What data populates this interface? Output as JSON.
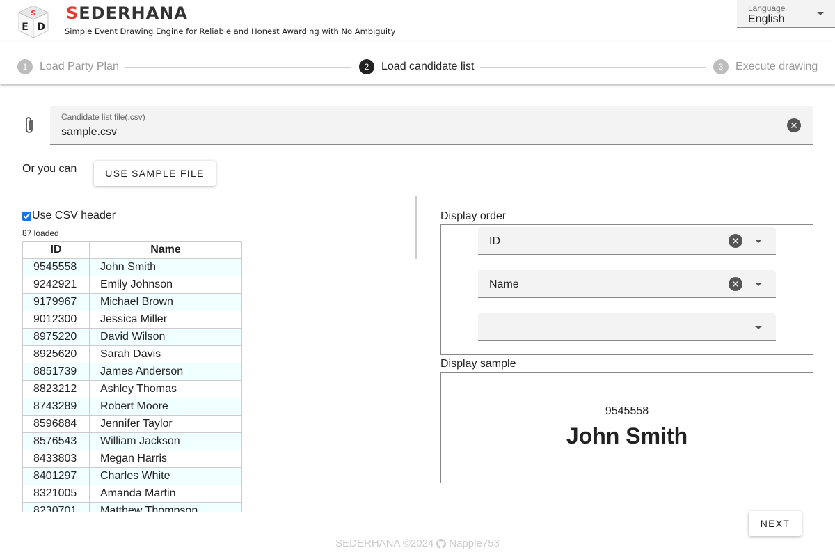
{
  "header": {
    "brand_first": "S",
    "brand_rest": "EDERHANA",
    "subtitle": "Simple Event Drawing Engine for Reliable and Honest Awarding with No Ambiguity",
    "logo_letters": [
      "S",
      "E",
      "D"
    ],
    "language": {
      "label": "Language",
      "value": "English"
    }
  },
  "stepper": {
    "steps": [
      {
        "num": "1",
        "label": "Load Party Plan",
        "active": false
      },
      {
        "num": "2",
        "label": "Load candidate list",
        "active": true
      },
      {
        "num": "3",
        "label": "Execute drawing",
        "active": false
      }
    ]
  },
  "file_input": {
    "label": "Candidate list file(.csv)",
    "value": "sample.csv",
    "icon": "paperclip-icon"
  },
  "alt_action": {
    "text": "Or you can",
    "button": "USE SAMPLE FILE"
  },
  "csv": {
    "use_header_label": "Use CSV header",
    "use_header_checked": true,
    "loaded_text": "87 loaded",
    "columns": [
      "ID",
      "Name"
    ],
    "rows": [
      [
        "9545558",
        "John Smith"
      ],
      [
        "9242921",
        "Emily Johnson"
      ],
      [
        "9179967",
        "Michael Brown"
      ],
      [
        "9012300",
        "Jessica Miller"
      ],
      [
        "8975220",
        "David Wilson"
      ],
      [
        "8925620",
        "Sarah Davis"
      ],
      [
        "8851739",
        "James Anderson"
      ],
      [
        "8823212",
        "Ashley Thomas"
      ],
      [
        "8743289",
        "Robert Moore"
      ],
      [
        "8596884",
        "Jennifer Taylor"
      ],
      [
        "8576543",
        "William Jackson"
      ],
      [
        "8433803",
        "Megan Harris"
      ],
      [
        "8401297",
        "Charles White"
      ],
      [
        "8321005",
        "Amanda Martin"
      ],
      [
        "8230701",
        "Matthew Thompson"
      ]
    ]
  },
  "display_order": {
    "label": "Display order",
    "selects": [
      "ID",
      "Name",
      ""
    ]
  },
  "display_sample": {
    "label": "Display sample",
    "id": "9545558",
    "name": "John Smith"
  },
  "next_button": "NEXT",
  "footer": {
    "text": "SEDERHANA ©2024",
    "user": "Napple753"
  },
  "colors": {
    "accent_red": "#e53935",
    "row_tint": "#f0ffff",
    "active_step": "#222222"
  }
}
